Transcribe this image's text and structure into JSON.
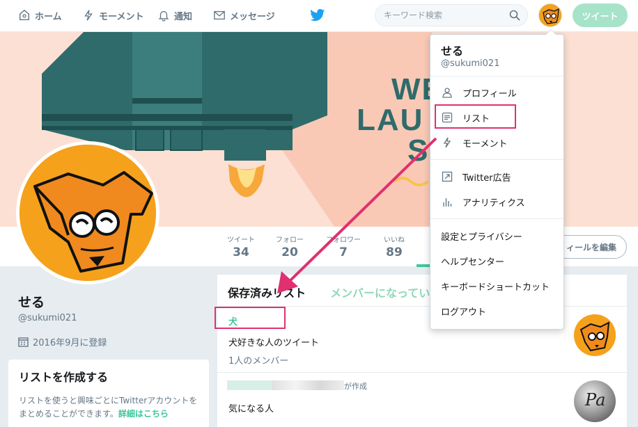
{
  "nav": {
    "home": "ホーム",
    "moments": "モーメント",
    "notifications": "通知",
    "messages": "メッセージ",
    "search_placeholder": "キーワード検索",
    "tweet_button": "ツイート"
  },
  "banner": {
    "line1": "WE",
    "line2": "LAU",
    "line3": "S"
  },
  "profile": {
    "name": "せる",
    "handle": "@sukumi021",
    "joined": "2016年9月に登録",
    "edit_button": "ィールを編集"
  },
  "stats": [
    {
      "label": "ツイート",
      "value": "34"
    },
    {
      "label": "フォロー",
      "value": "20"
    },
    {
      "label": "フォロワー",
      "value": "7"
    },
    {
      "label": "いいね",
      "value": "89"
    }
  ],
  "create_list": {
    "title": "リストを作成する",
    "body": "リストを使うと興味ごとにTwitterアカウントをまとめることができます。",
    "link": "詳細はこちら"
  },
  "lists": {
    "tab_saved": "保存済みリスト",
    "tab_member": "メンバーになってい",
    "items": [
      {
        "name": "犬",
        "description": "犬好きな人のツイート",
        "members": "1人のメンバー"
      },
      {
        "creator_suffix": "が作成",
        "description": "気になる人"
      }
    ]
  },
  "dropdown": {
    "name": "せる",
    "handle": "@sukumi021",
    "items": [
      "プロフィール",
      "リスト",
      "モーメント",
      "Twitter広告",
      "アナリティクス",
      "設定とプライバシー",
      "ヘルプセンター",
      "キーボードショートカット",
      "ログアウト"
    ]
  },
  "colors": {
    "accent": "#3ec69b",
    "highlight": "#e0306f",
    "banner_bg": "#fce0d4",
    "rocket": "#2f6b6b"
  }
}
